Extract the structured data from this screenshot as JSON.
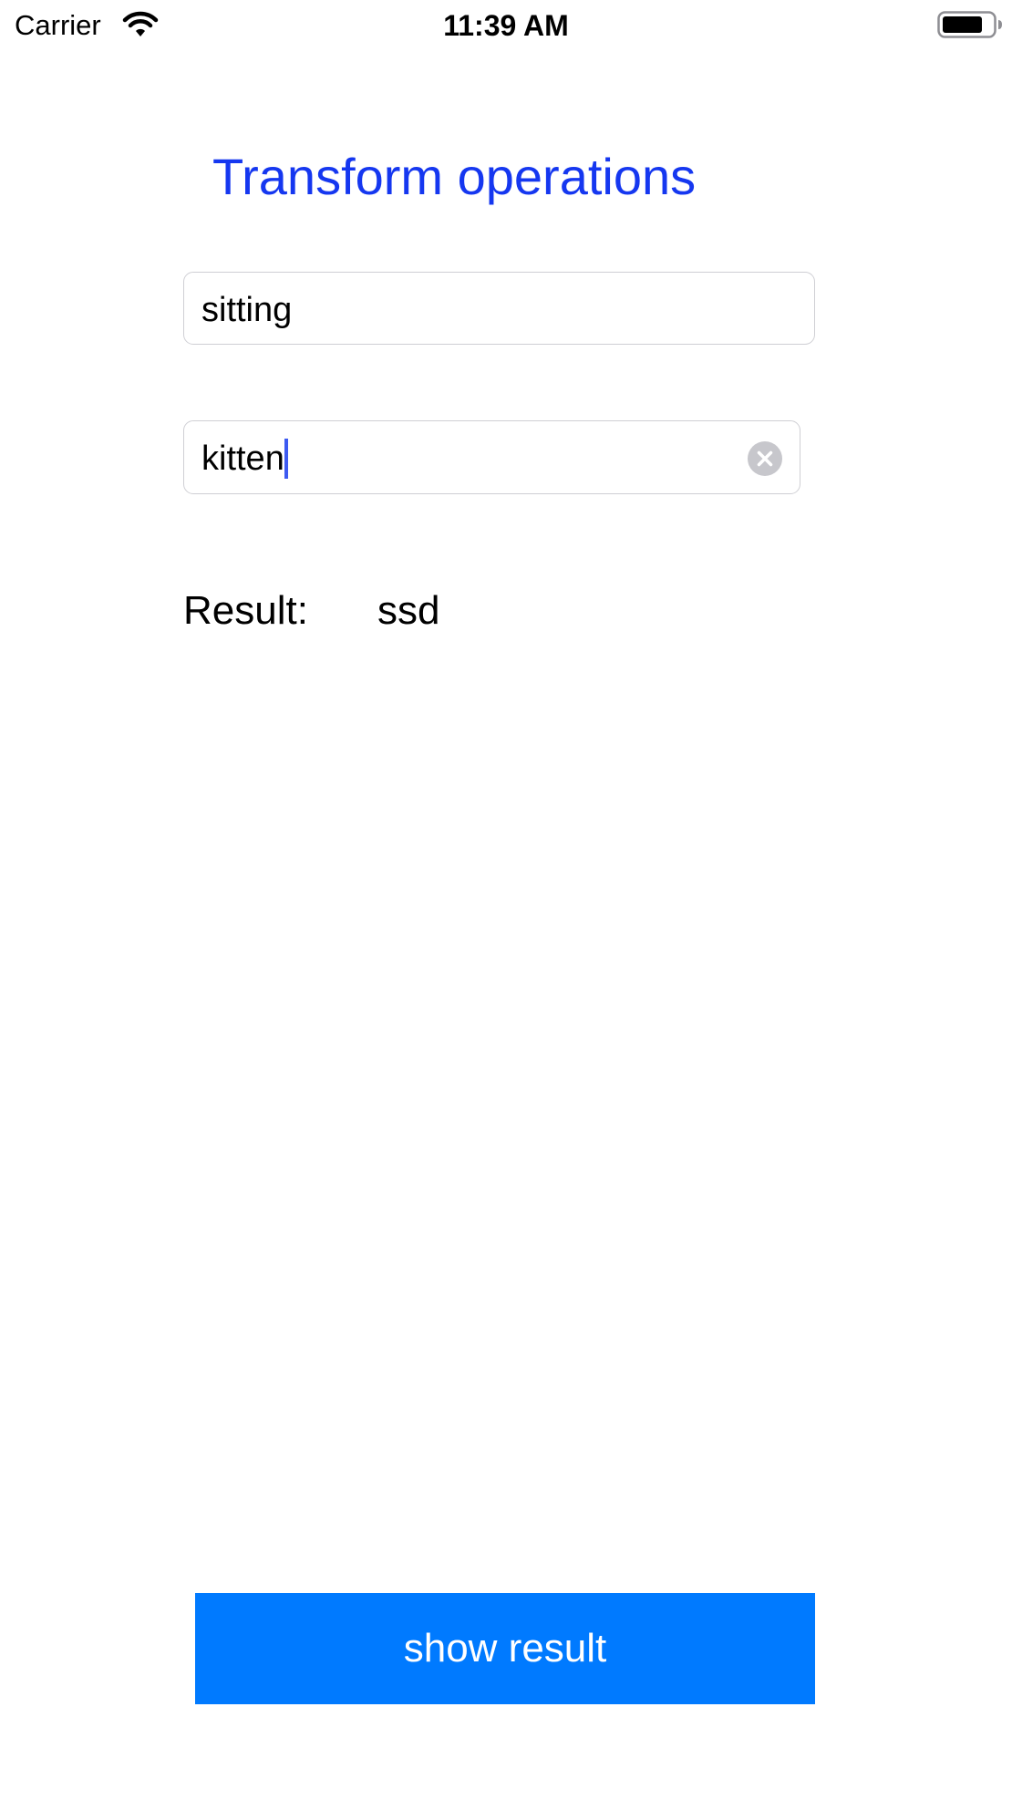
{
  "status_bar": {
    "carrier": "Carrier",
    "time": "11:39 AM",
    "wifi_icon": "wifi-icon",
    "battery_icon": "battery-icon"
  },
  "page": {
    "title": "Transform operations"
  },
  "inputs": {
    "first_value": "sitting",
    "second_value": "kitten",
    "clear_icon": "clear-circle-icon"
  },
  "result": {
    "label": "Result:",
    "value": "ssd"
  },
  "actions": {
    "show_result_label": "show result"
  },
  "colors": {
    "title": "#1537f0",
    "button_bg": "#007aff",
    "button_text": "#ffffff",
    "caret": "#3d5af1",
    "field_border": "#cfcfd4"
  }
}
